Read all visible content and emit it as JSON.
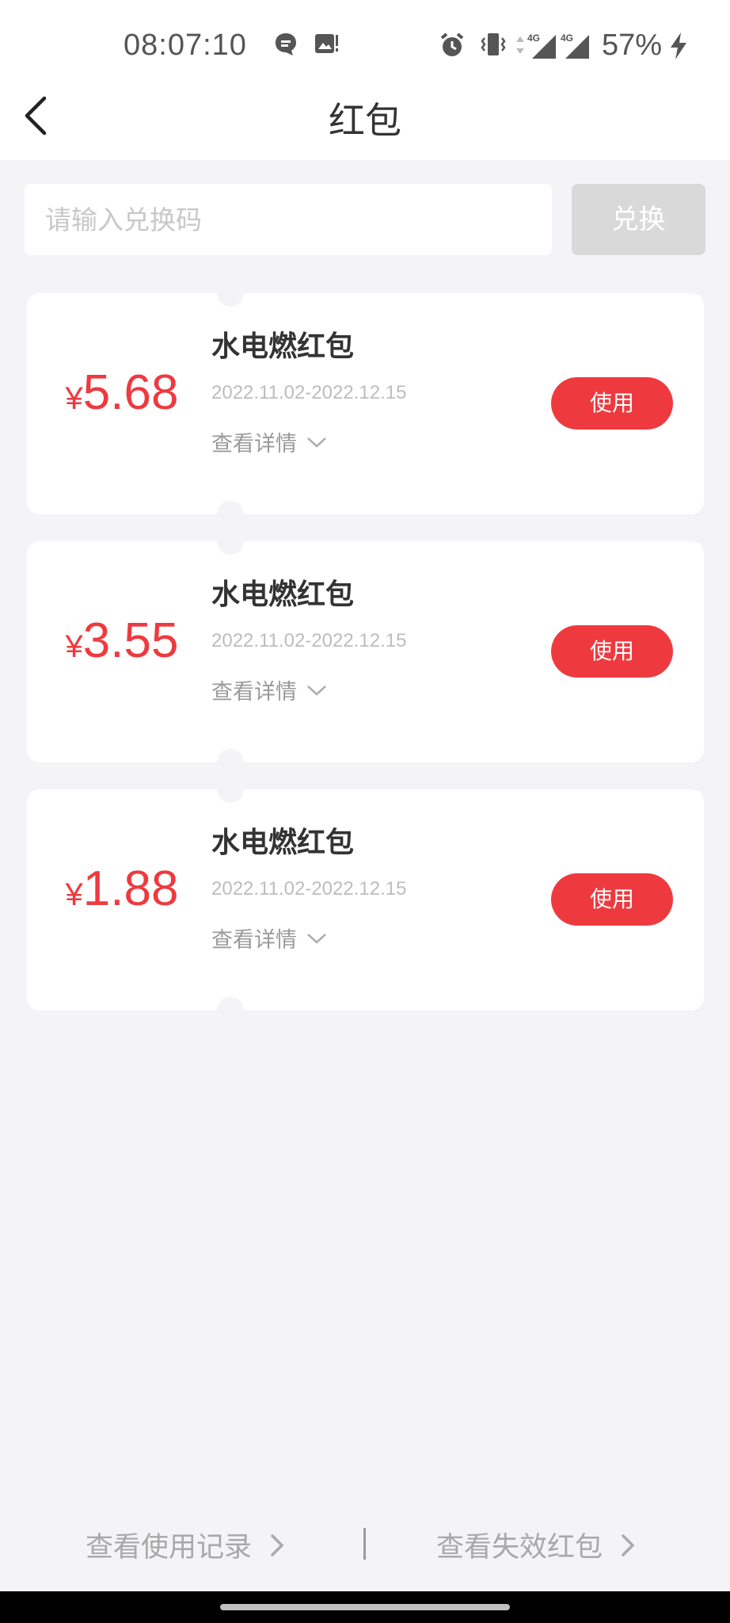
{
  "status_bar": {
    "time": "08:07:10",
    "battery": "57%",
    "network_labels": [
      "4G",
      "4G"
    ],
    "icons": [
      "message-icon",
      "image-icon",
      "alarm-icon",
      "vibrate-icon",
      "data-arrows-icon",
      "signal-icon",
      "signal-icon",
      "charging-icon"
    ]
  },
  "header": {
    "title": "红包",
    "back_icon": "chevron-left-icon"
  },
  "redeem": {
    "placeholder": "请输入兑换码",
    "button_label": "兑换"
  },
  "coupons": [
    {
      "currency": "¥",
      "amount": "5.68",
      "title": "水电燃红包",
      "date_range": "2022.11.02-2022.12.15",
      "detail_label": "查看详情",
      "use_label": "使用"
    },
    {
      "currency": "¥",
      "amount": "3.55",
      "title": "水电燃红包",
      "date_range": "2022.11.02-2022.12.15",
      "detail_label": "查看详情",
      "use_label": "使用"
    },
    {
      "currency": "¥",
      "amount": "1.88",
      "title": "水电燃红包",
      "date_range": "2022.11.02-2022.12.15",
      "detail_label": "查看详情",
      "use_label": "使用"
    }
  ],
  "footer": {
    "usage_record": "查看使用记录",
    "expired": "查看失效红包"
  },
  "colors": {
    "accent": "#ee3a3f",
    "background": "#f4f4f6",
    "disabled_button": "#d9d9d9"
  }
}
